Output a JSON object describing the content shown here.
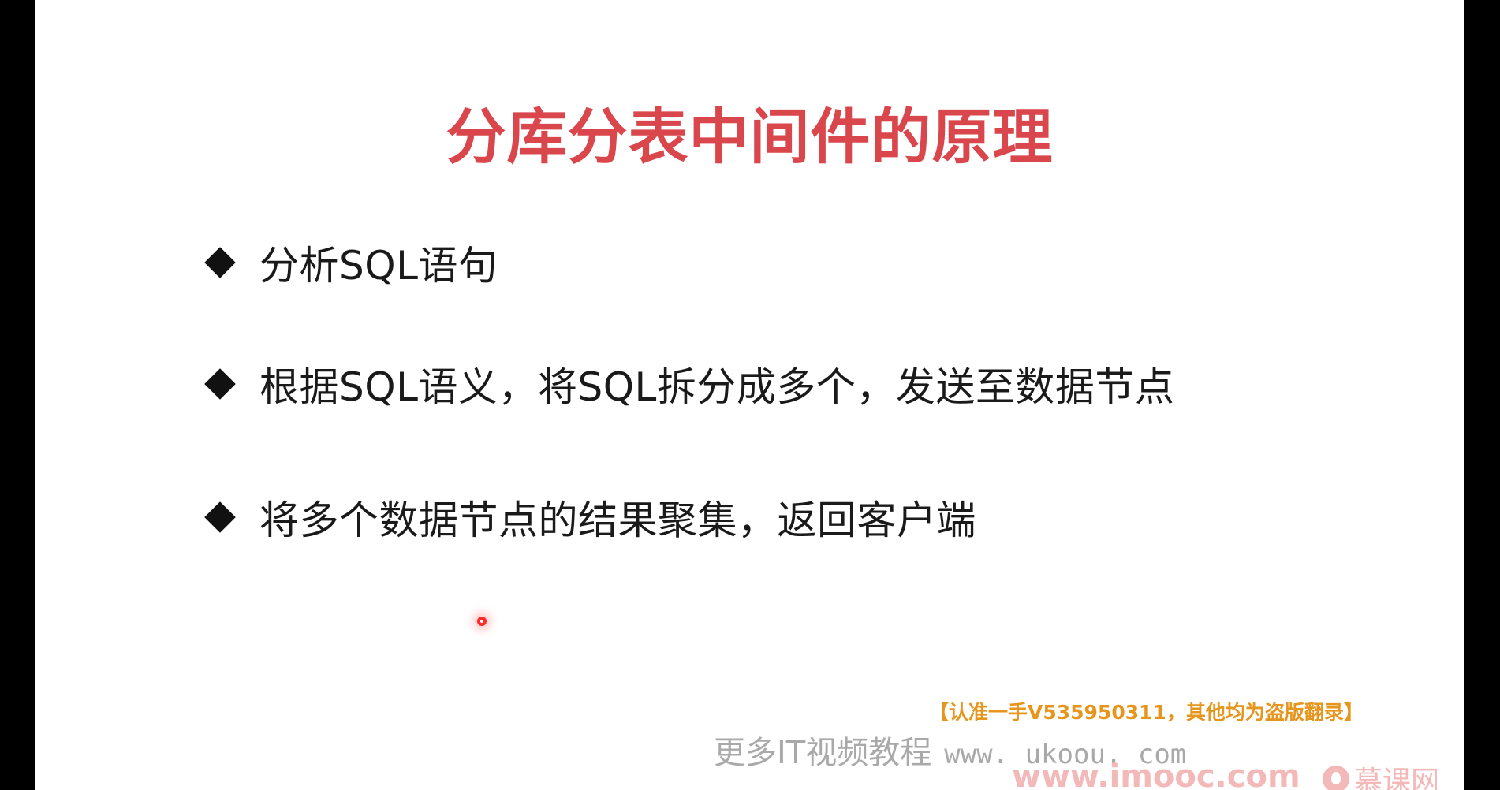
{
  "slide": {
    "title": "分库分表中间件的原理",
    "bullets": [
      "分析SQL语句",
      "根据SQL语义，将SQL拆分成多个，发送至数据节点",
      "将多个数据节点的结果聚集，返回客户端"
    ]
  },
  "watermarks": {
    "notice": "【认准一手V535950311，其他均为盗版翻录】",
    "more_videos": "更多IT视频教程",
    "ukoou_url": "www. ukoou. com",
    "imooc_url": "www.imooc.com",
    "brand_name": "慕课网"
  },
  "colors": {
    "title": "#d9464b",
    "notice": "#e6951d",
    "imooc": "#f3b8b8",
    "background": "#ffffff",
    "side_bars": "#000000"
  }
}
